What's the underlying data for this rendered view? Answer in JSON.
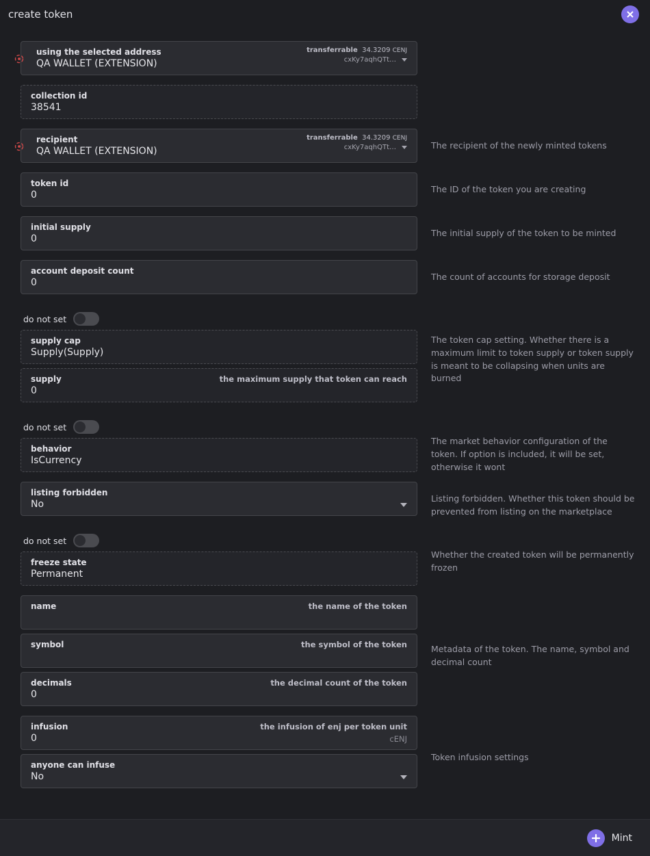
{
  "page_title": "create token",
  "toggles": {
    "do_not_set": "do not set"
  },
  "address": {
    "using_label": "using the selected address",
    "recipient_label": "recipient",
    "wallet_name": "QA WALLET (EXTENSION)",
    "transferrable_label": "transferrable",
    "balance": "34.3209",
    "ticker": "CENJ",
    "short_addr": "cxKy7aqhQTt…"
  },
  "recipient_desc": "The recipient of the newly minted tokens",
  "collection_id": {
    "label": "collection id",
    "value": "38541"
  },
  "token_id": {
    "label": "token id",
    "value": "0",
    "desc": "The ID of the token you are creating"
  },
  "initial_supply": {
    "label": "initial supply",
    "value": "0",
    "desc": "The initial supply of the token to be minted"
  },
  "account_deposit": {
    "label": "account deposit count",
    "value": "0",
    "desc": "The count of accounts for storage deposit"
  },
  "supply_cap": {
    "label": "supply cap",
    "value": "Supply(Supply)",
    "supply_label": "supply",
    "supply_hint": "the maximum supply that token can reach",
    "supply_value": "0",
    "desc": "The token cap setting. Whether there is a maximum limit to token supply or token supply is meant to be collapsing when units are burned"
  },
  "behavior": {
    "label": "behavior",
    "value": "IsCurrency",
    "desc": "The market behavior configuration of the token. If option is included, it will be set, otherwise it wont"
  },
  "listing_forbidden": {
    "label": "listing forbidden",
    "value": "No",
    "desc": "Listing forbidden. Whether this token should be prevented from listing on the marketplace"
  },
  "freeze_state": {
    "label": "freeze state",
    "value": "Permanent",
    "desc": "Whether the created token will be permanently frozen"
  },
  "metadata": {
    "name_label": "name",
    "name_hint": "the name of the token",
    "symbol_label": "symbol",
    "symbol_hint": "the symbol of the token",
    "decimals_label": "decimals",
    "decimals_hint": "the decimal count of the token",
    "decimals_value": "0",
    "desc": "Metadata of the token. The name, symbol and decimal count"
  },
  "infusion": {
    "label": "infusion",
    "hint": "the infusion of enj per token unit",
    "value": "0",
    "unit": "cENJ",
    "anyone_label": "anyone can infuse",
    "anyone_value": "No",
    "desc": "Token infusion settings"
  },
  "mint_label": "Mint"
}
